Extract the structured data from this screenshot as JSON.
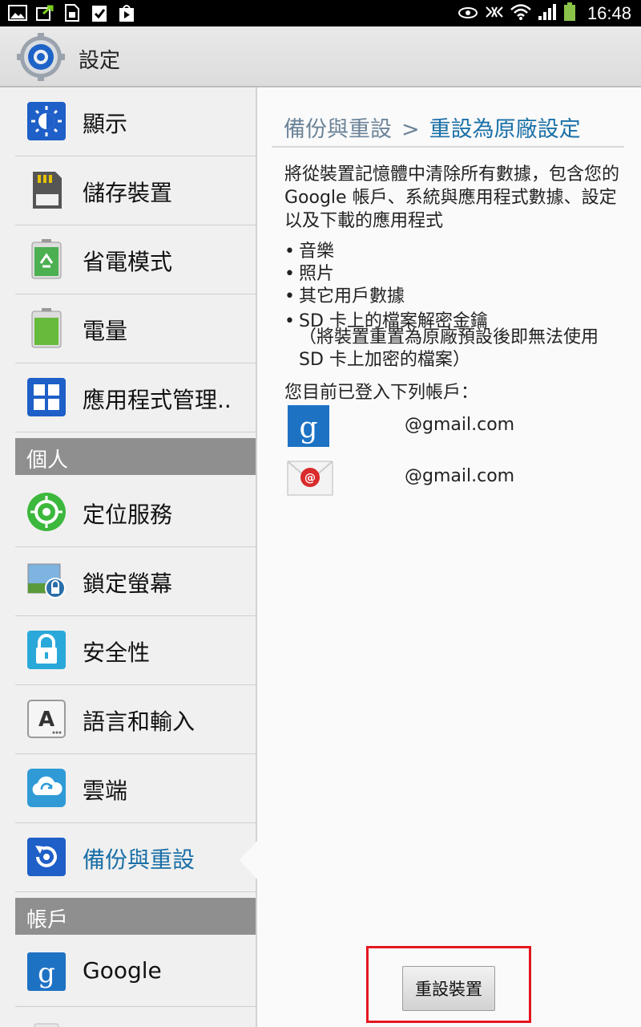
{
  "status_bar": {
    "time": "16:48",
    "left_icons": [
      "image-notification-icon",
      "sync-notification-icon",
      "sim-card-icon",
      "clipboard-check-icon",
      "play-store-icon"
    ],
    "right_icons": [
      "eye-icon",
      "nfc-vibrate-icon",
      "wifi-icon",
      "signal-icon",
      "battery-icon"
    ],
    "battery_color": "#8bc34a"
  },
  "action_bar": {
    "title": "設定",
    "icon": "settings-gear-icon"
  },
  "sidebar": {
    "items": [
      {
        "label": "顯示",
        "icon": "display-icon",
        "color": "#1e5fc8"
      },
      {
        "label": "儲存裝置",
        "icon": "sd-card-icon",
        "color": "#555555"
      },
      {
        "label": "省電模式",
        "icon": "power-saving-battery-icon",
        "color": "#4caf50"
      },
      {
        "label": "電量",
        "icon": "battery-icon",
        "color": "#66bb3a"
      },
      {
        "label": "應用程式管理..",
        "icon": "app-grid-icon",
        "color": "#1e5fc8"
      }
    ],
    "section_personal": "個人",
    "personal_items": [
      {
        "label": "定位服務",
        "icon": "location-target-icon",
        "color": "#3cb83c"
      },
      {
        "label": "鎖定螢幕",
        "icon": "lock-screen-icon",
        "color": "#2a6fa8"
      },
      {
        "label": "安全性",
        "icon": "padlock-icon",
        "color": "#29a8d9"
      },
      {
        "label": "語言和輸入",
        "icon": "keyboard-a-icon",
        "color": "#333333"
      },
      {
        "label": "雲端",
        "icon": "cloud-sync-icon",
        "color": "#2f9ad6"
      },
      {
        "label": "備份與重設",
        "icon": "backup-reset-icon",
        "color": "#1e5fc8"
      }
    ],
    "section_accounts": "帳戶",
    "account_items": [
      {
        "label": "Google",
        "icon": "google-icon",
        "color": "#1d72c4"
      }
    ]
  },
  "content": {
    "breadcrumb_parent": "備份與重設",
    "breadcrumb_separator": ">",
    "breadcrumb_current": "重設為原廠設定",
    "description": "將從裝置記憶體中清除所有數據，包含您的 Google 帳戶、系統與應用程式數據、設定以及下載的應用程式",
    "bullets": [
      "音樂",
      "照片",
      "其它用戶數據",
      "SD 卡上的檔案解密金鑰"
    ],
    "bullet_mark": "•",
    "note": "（將裝置重置為原廠預設後即無法使用 SD 卡上加密的檔案）",
    "accounts_heading": "您目前已登入下列帳戶：",
    "accounts": [
      {
        "icon": "google-account-icon",
        "email": "@gmail.com"
      },
      {
        "icon": "email-account-icon",
        "email": "@gmail.com"
      }
    ],
    "reset_button": "重設裝置",
    "highlight_color": "#e4171f"
  }
}
